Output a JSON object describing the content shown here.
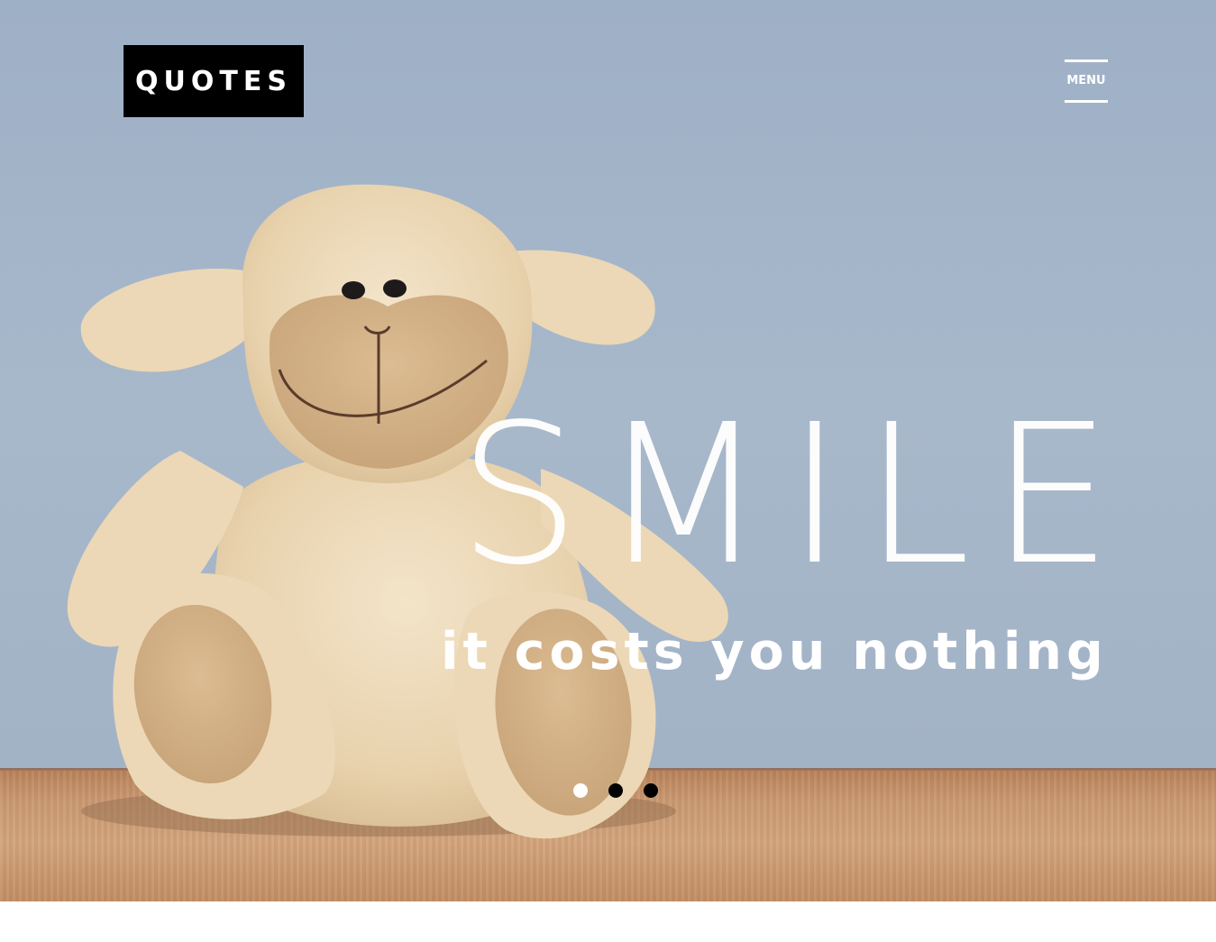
{
  "header": {
    "logo_text": "QUOTES",
    "menu_label": "MENU"
  },
  "hero": {
    "headline": "SMILE",
    "subline": "it costs you nothing",
    "image_subject": "plush toy lamb sitting on a wooden shelf against a blue wall"
  },
  "slider": {
    "dots": [
      {
        "state": "active",
        "color": "#ffffff"
      },
      {
        "state": "inactive",
        "color": "#000000"
      },
      {
        "state": "inactive",
        "color": "#000000"
      }
    ]
  },
  "colors": {
    "wall": "#a3b3c6",
    "floor": "#c99870",
    "logo_bg": "#000000",
    "text": "#ffffff"
  }
}
